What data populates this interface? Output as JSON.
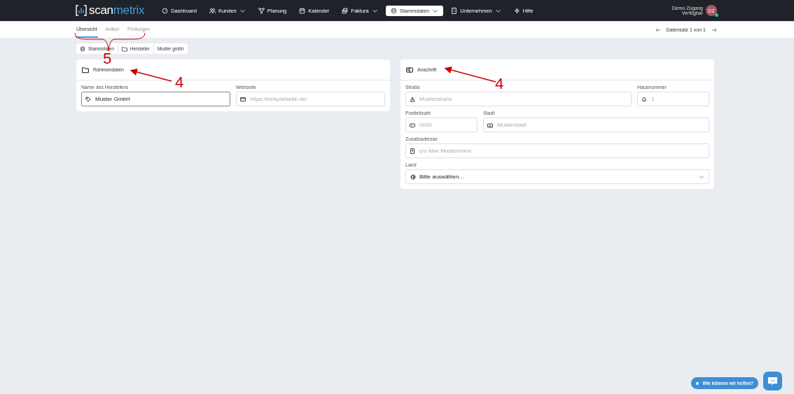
{
  "topbar": {
    "logo": {
      "part_1": "scan",
      "part_2": "metrix"
    },
    "nav": [
      {
        "label": "Dashboard",
        "dropdown": false,
        "selected": false
      },
      {
        "label": "Kunden",
        "dropdown": true,
        "selected": false
      },
      {
        "label": "Planung",
        "dropdown": false,
        "selected": false
      },
      {
        "label": "Kalender",
        "dropdown": false,
        "selected": false
      },
      {
        "label": "Faktura",
        "dropdown": true,
        "selected": false
      },
      {
        "label": "Stammdaten",
        "dropdown": true,
        "selected": true
      },
      {
        "label": "Unternehmen",
        "dropdown": true,
        "selected": false
      },
      {
        "label": "Hilfe",
        "dropdown": false,
        "selected": false
      }
    ],
    "user": {
      "name": "Demo Zugang",
      "status": "Verfügbar",
      "initials": "DZ",
      "online": true
    }
  },
  "subnav": {
    "tabs": [
      {
        "label": "Übersicht",
        "selected": true
      },
      {
        "label": "Artikel",
        "selected": false
      },
      {
        "label": "Prüfungen",
        "selected": false
      }
    ],
    "pager": "Datensatz 1 von 1"
  },
  "breadcrumb": [
    "Stammdaten",
    "Hersteller",
    "Muster gmbh"
  ],
  "cards": [
    {
      "title": "Rahmendaten",
      "rows": [
        [
          {
            "label": "Name des Herstellers",
            "value": "Muster GmbH",
            "focused": true
          },
          {
            "label": "Webseite",
            "placeholder": "https://beispielseite.de/",
            "focused": false
          }
        ]
      ]
    },
    {
      "title": "Anschrift",
      "rows": [
        [
          {
            "label": "Straße",
            "placeholder": "Musterstraße",
            "focused": false
          },
          {
            "label": "Hausnummer",
            "placeholder": "1",
            "focused": false
          }
        ],
        [
          {
            "label": "Postleitzahl",
            "placeholder": "0000",
            "focused": false
          },
          {
            "label": "Stadt",
            "placeholder": "Musterstadt",
            "focused": false
          }
        ],
        [
          {
            "label": "Zusatzadresse",
            "placeholder": "c/o Max Mustermann",
            "focused": false
          }
        ],
        [
          {
            "label": "Land",
            "select": "Bitte auswählen...",
            "focused": false
          }
        ]
      ]
    }
  ],
  "chat": {
    "label": "Wie können wir helfen?"
  },
  "annotations": [
    {
      "kind": "brace",
      "label": "5"
    },
    {
      "kind": "arrow",
      "label": "4"
    },
    {
      "kind": "arrow",
      "label": "4"
    }
  ]
}
